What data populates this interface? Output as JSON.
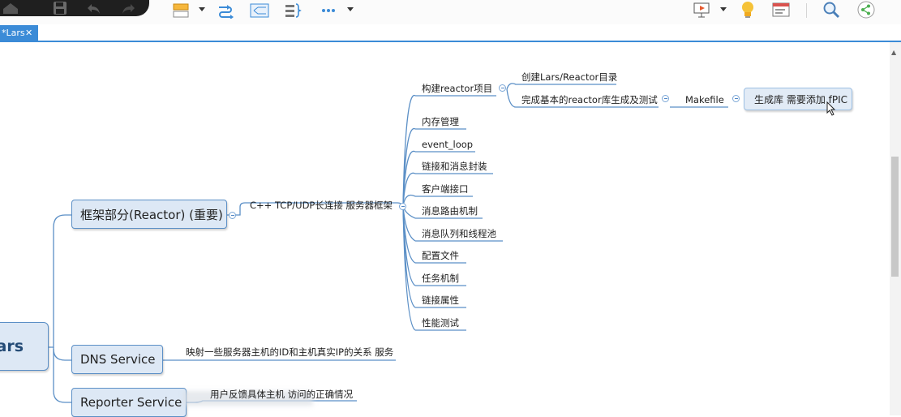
{
  "tab": {
    "title": "*Lars",
    "close": "✕"
  },
  "toolbar": {
    "icons": [
      "home-icon",
      "save-icon",
      "undo-icon",
      "redo-icon",
      "insert-topic-icon",
      "relationship-icon",
      "boundary-icon",
      "summary-icon",
      "more-icon",
      "presentation-icon",
      "idea-icon",
      "panel-icon",
      "search-icon",
      "share-icon"
    ]
  },
  "colors": {
    "accent": "#3b8bd7",
    "node_border": "#5b8fc6",
    "node_fill": "#dde8f5",
    "line": "#5b8fc6"
  },
  "map": {
    "root": "Lars",
    "framework": {
      "label": "框架部分(Reactor) (重要)",
      "branch": "C++ TCP/UDP长连接 服务器框架",
      "children": [
        "构建reactor项目",
        "内存管理",
        "event_loop",
        "链接和消息封装",
        "客户端接口",
        "消息路由机制",
        "消息队列和线程池",
        "配置文件",
        "任务机制",
        "链接属性",
        "性能测试"
      ],
      "reactor_children": [
        "创建Lars/Reactor目录",
        "完成基本的reactor库生成及测试"
      ],
      "makefile": "Makefile",
      "makefile_child": "生成库 需要添加 fPIC"
    },
    "dns": {
      "label": "DNS Service",
      "child": "映射一些服务器主机的ID和主机真实IP的关系 服务"
    },
    "reporter": {
      "label": "Reporter Service",
      "child": "用户反馈具体主机 访问的正确情况"
    }
  }
}
